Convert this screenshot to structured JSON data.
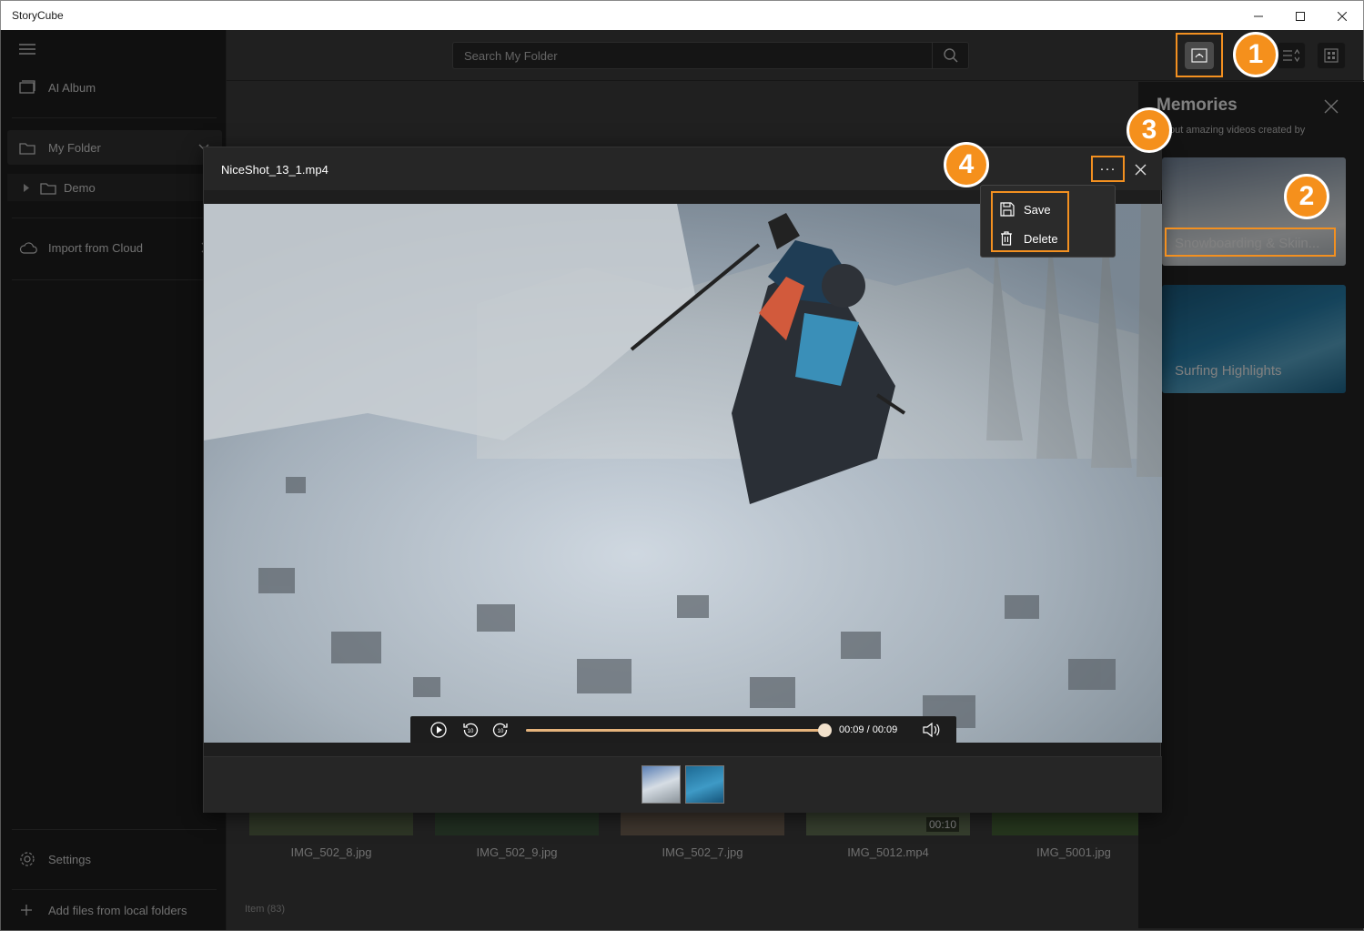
{
  "window": {
    "title": "StoryCube",
    "minimize_icon": "minimize-icon",
    "maximize_icon": "maximize-icon",
    "close_icon": "close-icon"
  },
  "sidebar": {
    "ai_album": "AI Album",
    "my_folder": "My Folder",
    "demo": "Demo",
    "import_cloud": "Import from Cloud",
    "settings": "Settings",
    "add_files": "Add files from local folders"
  },
  "search": {
    "placeholder": "Search My Folder"
  },
  "gallery": {
    "items": [
      {
        "name": "IMG_502_8.jpg"
      },
      {
        "name": "IMG_502_9.jpg"
      },
      {
        "name": "IMG_502_7.jpg"
      },
      {
        "name": "IMG_5012.mp4",
        "duration": "00:10"
      },
      {
        "name": "IMG_5001.jpg"
      }
    ],
    "count": "Item (83)"
  },
  "memories": {
    "title": "Memories",
    "subtitle": "ck out amazing videos created by",
    "cards": [
      {
        "caption": "Snowboarding & Skiin..."
      },
      {
        "caption": "Surfing Highlights"
      }
    ]
  },
  "player": {
    "filename": "NiceShot_13_1.mp4",
    "more_label": "···",
    "time": "00:09 / 00:09",
    "progress": 1.0
  },
  "menu": {
    "save": "Save",
    "delete": "Delete"
  },
  "badges": {
    "b1": "1",
    "b2": "2",
    "b3": "3",
    "b4": "4"
  },
  "colors": {
    "accent": "#f39020",
    "badge": "#f5901c",
    "progress": "#e6b47c"
  }
}
